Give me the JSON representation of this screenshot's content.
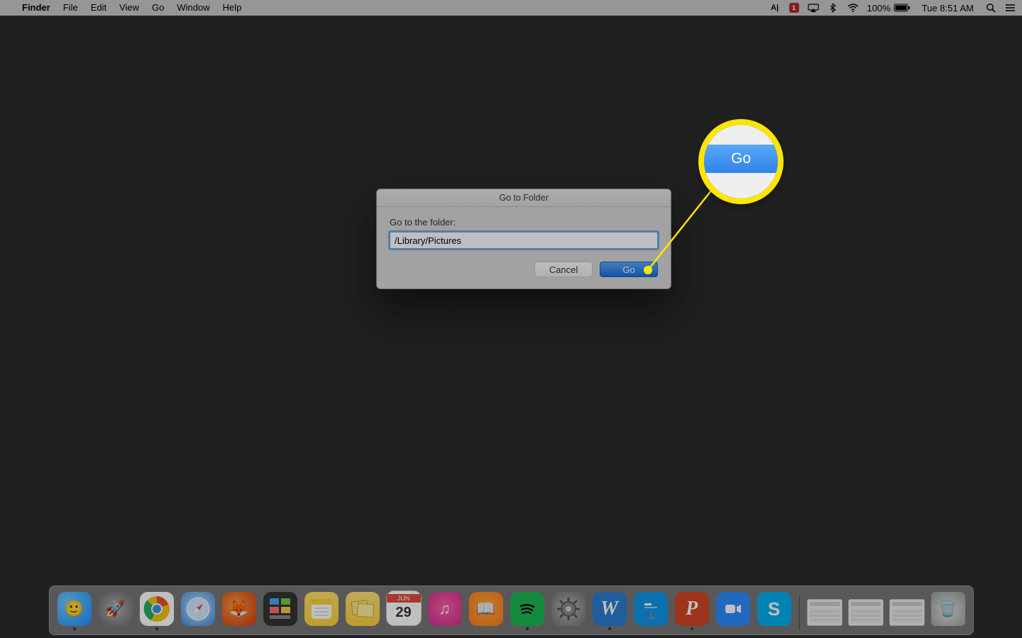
{
  "menubar": {
    "app_name": "Finder",
    "items": [
      "File",
      "Edit",
      "View",
      "Go",
      "Window",
      "Help"
    ],
    "battery_pct": "100%",
    "clock": "Tue 8:51 AM"
  },
  "dialog": {
    "title": "Go to Folder",
    "label": "Go to the folder:",
    "input_value": "/Library/Pictures",
    "cancel": "Cancel",
    "go": "Go"
  },
  "callout": {
    "go": "Go"
  },
  "calendar": {
    "month": "JUN",
    "day": "29"
  },
  "dock": {
    "apps": [
      {
        "name": "finder",
        "running": true
      },
      {
        "name": "launchpad",
        "running": false
      },
      {
        "name": "chrome",
        "running": true
      },
      {
        "name": "safari",
        "running": false
      },
      {
        "name": "firefox",
        "running": false
      },
      {
        "name": "mission-control",
        "running": false
      },
      {
        "name": "notes",
        "running": false
      },
      {
        "name": "stickies",
        "running": false
      },
      {
        "name": "calendar",
        "running": false
      },
      {
        "name": "itunes",
        "running": false
      },
      {
        "name": "ibooks",
        "running": false
      },
      {
        "name": "spotify",
        "running": true
      },
      {
        "name": "system-preferences",
        "running": false
      },
      {
        "name": "word",
        "running": true
      },
      {
        "name": "keynote",
        "running": false
      },
      {
        "name": "powerpoint",
        "running": true
      },
      {
        "name": "zoom",
        "running": false
      },
      {
        "name": "skype",
        "running": false
      }
    ],
    "minimized_windows": 3
  }
}
